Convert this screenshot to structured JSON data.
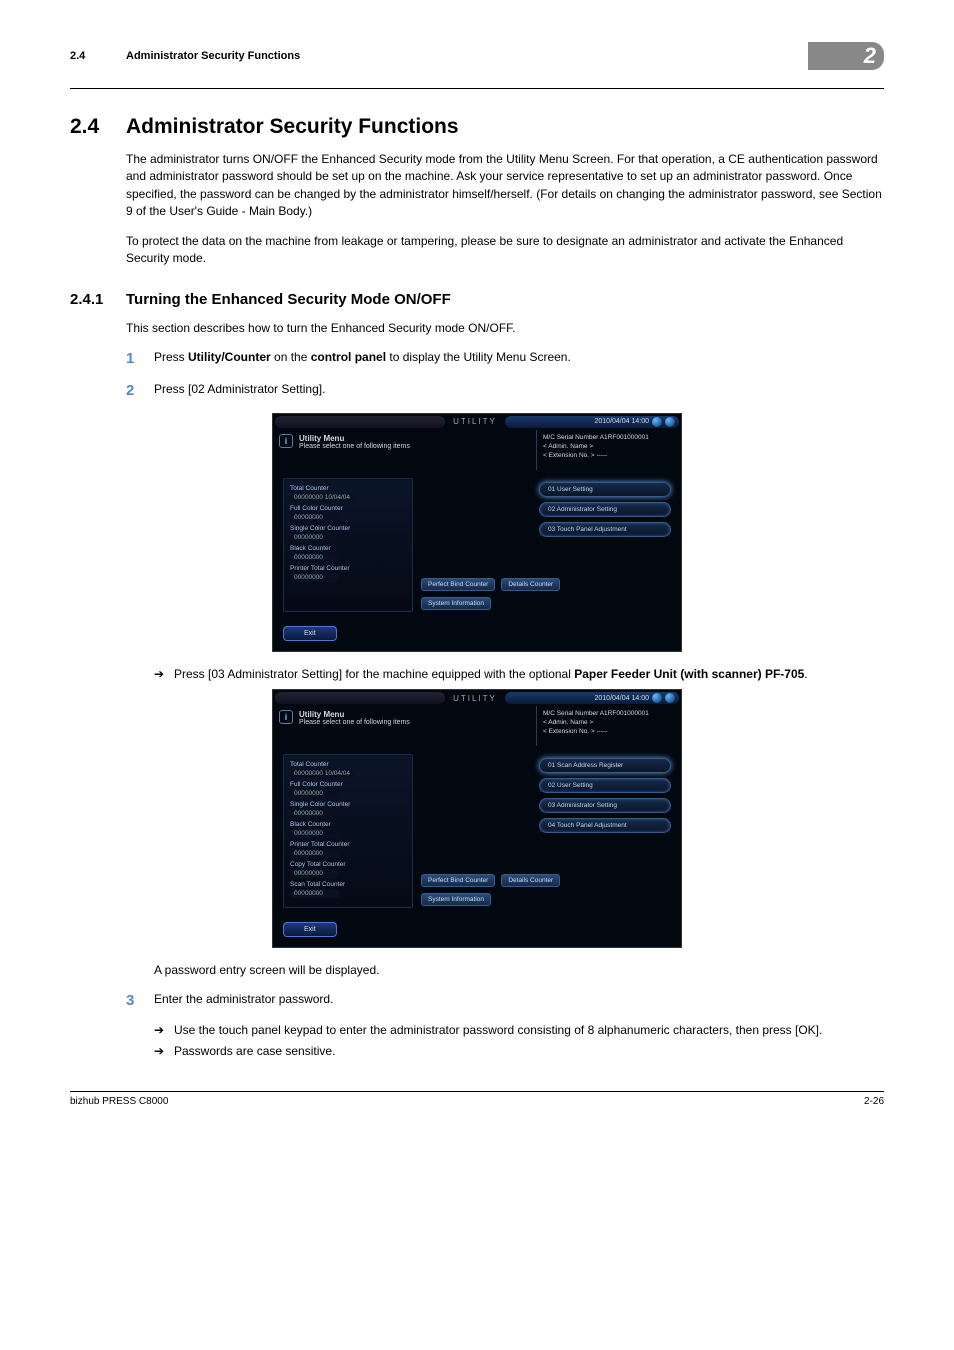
{
  "header": {
    "section_number": "2.4",
    "section_title": "Administrator Security Functions",
    "chapter_badge": "2"
  },
  "h2": {
    "num": "2.4",
    "title": "Administrator Security Functions"
  },
  "p1": "The administrator turns ON/OFF the Enhanced Security mode from the Utility Menu Screen. For that operation, a CE authentication password and administrator password should be set up on the machine. Ask your service representative to set up an administrator password. Once specified, the password can be changed by the administrator himself/herself. (For details on changing the administrator password, see Section 9 of the User's Guide - Main Body.)",
  "p2": "To protect the data on the machine from leakage or tampering, please be sure to designate an administrator and activate the Enhanced Security mode.",
  "h3": {
    "num": "2.4.1",
    "title": "Turning the Enhanced Security Mode ON/OFF"
  },
  "p3": "This section describes how to turn the Enhanced Security mode ON/OFF.",
  "step1": {
    "n": "1",
    "pre": "Press ",
    "b1": "Utility/Counter",
    "mid": " on the ",
    "b2": "control panel",
    "post": " to display the Utility Menu Screen."
  },
  "step2": {
    "n": "2",
    "text": "Press [02 Administrator Setting]."
  },
  "arrow1": {
    "pre": "Press [03 Administrator Setting] for the machine equipped with the optional ",
    "b": "Paper Feeder Unit (with scanner) PF-705",
    "post": "."
  },
  "p4": "A password entry screen will be displayed.",
  "step3": {
    "n": "3",
    "text": "Enter the administrator password."
  },
  "arrow2": "Use the touch panel keypad to enter the administrator password consisting of 8 alphanumeric characters, then press [OK].",
  "arrow3": "Passwords are case sensitive.",
  "footer": {
    "left": "bizhub PRESS C8000",
    "right": "2-26"
  },
  "screen_common": {
    "title": "UTILITY",
    "datetime": "2010/04/04 14:00",
    "info_title": "Utility Menu",
    "info_sub": "Please select one of following items",
    "meta1": "M/C Serial Number  A1RF001000001",
    "meta2": "< Admin. Name >",
    "meta3": "< Extension No. >  -----",
    "btn_perfect": "Perfect Bind Counter",
    "btn_details": "Details Counter",
    "btn_sysinfo": "System Information",
    "exit": "Exit"
  },
  "screen1": {
    "counters": {
      "total_l": "Total Counter",
      "total_v": "00000000   10/04/04",
      "full_l": "Full Color Counter",
      "full_v": "00000000",
      "single_l": "Single Color Counter",
      "single_v": "00000000",
      "black_l": "Black Counter",
      "black_v": "00000000",
      "printer_l": "Printer Total Counter",
      "printer_v": "00000000"
    },
    "menu": {
      "m1": "01 User Setting",
      "m2": "02 Administrator Setting",
      "m3": "03 Touch Panel Adjustment"
    }
  },
  "screen2": {
    "counters": {
      "total_l": "Total Counter",
      "total_v": "00000000   10/04/04",
      "full_l": "Full Color Counter",
      "full_v": "00000000",
      "single_l": "Single Color Counter",
      "single_v": "00000000",
      "black_l": "Black Counter",
      "black_v": "00000000",
      "printer_l": "Printer Total Counter",
      "printer_v": "00000000",
      "copy_l": "Copy Total Counter",
      "copy_v": "00000000",
      "scan_l": "Scan Total Counter",
      "scan_v": "00000000"
    },
    "menu": {
      "m1": "01 Scan Address Register",
      "m2": "02 User Setting",
      "m3": "03 Administrator Setting",
      "m4": "04 Touch Panel Adjustment"
    }
  }
}
